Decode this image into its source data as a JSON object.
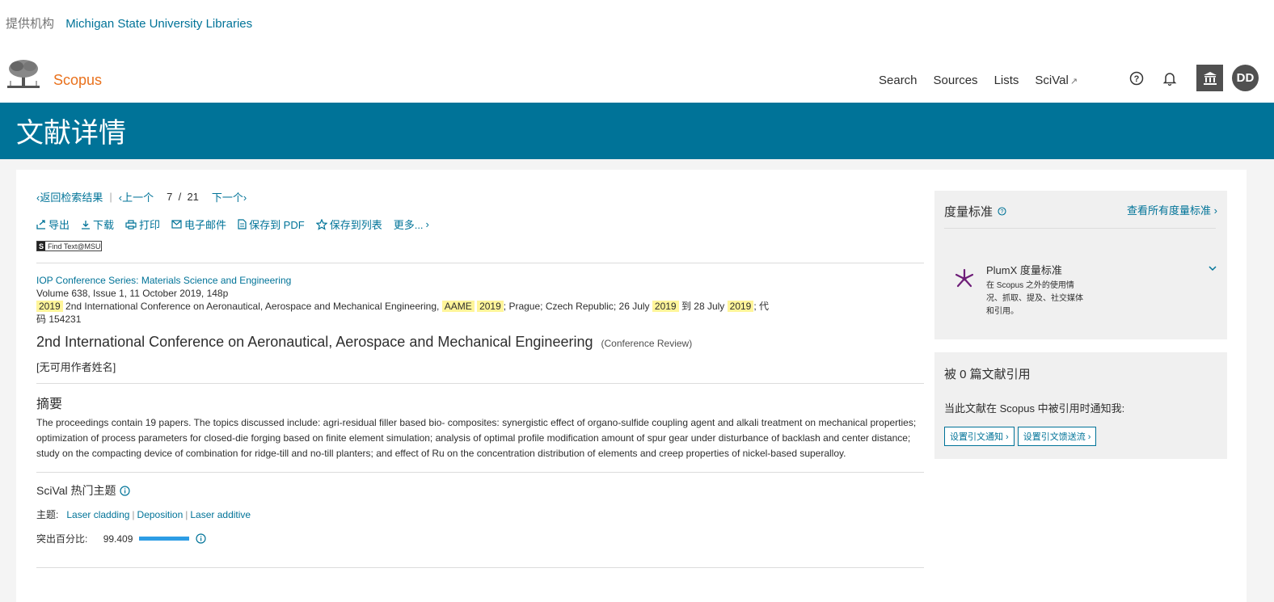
{
  "provider": {
    "label": "提供机构",
    "institution": "Michigan State University Libraries"
  },
  "brand": {
    "name": "Scopus"
  },
  "nav": {
    "search": "Search",
    "sources": "Sources",
    "lists": "Lists",
    "scival": "SciVal",
    "scival_ext": "↗"
  },
  "user": {
    "initials": "DD"
  },
  "page": {
    "title": "文献详情"
  },
  "results_nav": {
    "back": "返回检索结果",
    "prev": "上一个",
    "current": "7",
    "slash": "/",
    "total": "21",
    "next": "下一个"
  },
  "actions": {
    "export": "导出",
    "download": "下载",
    "print": "打印",
    "email": "电子邮件",
    "save_pdf": "保存到 PDF",
    "save_list": "保存到列表",
    "more": "更多..."
  },
  "findtext": {
    "label": "Find Text@MSU"
  },
  "source": {
    "journal": "IOP Conference Series: Materials Science and Engineering",
    "volume": "Volume 638, Issue 1, 11 October 2019, 148p",
    "conf_year1": "2019",
    "conf_name": "2nd International Conference on Aeronautical, Aerospace and Mechanical Engineering,",
    "conf_abbr": "AAME",
    "conf_year2": "2019",
    "location_date": "; Prague; Czech Republic; 26 July",
    "date_year1": "2019",
    "date_to": "到 28 July",
    "date_year2": "2019",
    "code_prefix": "; 代",
    "code": "码 154231"
  },
  "document": {
    "title": "2nd International Conference on Aeronautical, Aerospace and Mechanical Engineering",
    "type": "(Conference Review)",
    "authors": "[无可用作者姓名]"
  },
  "abstract": {
    "heading": "摘要",
    "text": "The proceedings contain 19 papers. The topics discussed include: agri-residual filler based bio- composites: synergistic effect of organo-sulfide coupling agent and alkali treatment on mechanical properties; optimization of process parameters for closed-die forging based on finite element simulation; analysis of optimal profile modification amount of spur gear under disturbance of backlash and center distance; study on the compacting device of combination for ridge-till and no-till planters; and effect of Ru on the concentration distribution of elements and creep properties of nickel-based superalloy."
  },
  "scival": {
    "heading": "SciVal 热门主题",
    "topic_label": "主题:",
    "topics": [
      "Laser cladding",
      "Deposition",
      "Laser additive"
    ],
    "prominence_label": "突出百分比:",
    "prominence_value": "99.409",
    "prominence_fraction": 0.99409
  },
  "metrics": {
    "title": "度量标准",
    "view_all": "查看所有度量标准",
    "plumx_title": "PlumX 度量标准",
    "plumx_desc": "在 Scopus 之外的使用情况、抓取、提及、社交媒体和引用。"
  },
  "cited_by": {
    "title": "被 0 篇文献引用",
    "note": "当此文献在 Scopus 中被引用时通知我:",
    "alert_button": "设置引文通知",
    "feed_button": "设置引文馈送流"
  },
  "colors": {
    "brand": "#e9711c",
    "banner": "#007398",
    "link": "#007398",
    "highlight": "#fff59a",
    "bar": "#2d9de5",
    "plumx": "#6e1e78"
  }
}
